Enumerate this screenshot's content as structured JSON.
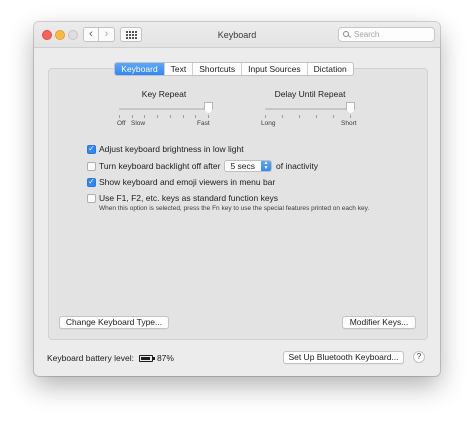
{
  "window": {
    "title": "Keyboard",
    "back_glyph": "‹",
    "forward_glyph": "›"
  },
  "search": {
    "placeholder": "Search"
  },
  "tabs": [
    {
      "label": "Keyboard",
      "active": true
    },
    {
      "label": "Text",
      "active": false
    },
    {
      "label": "Shortcuts",
      "active": false
    },
    {
      "label": "Input Sources",
      "active": false
    },
    {
      "label": "Dictation",
      "active": false
    }
  ],
  "key_repeat": {
    "title": "Key Repeat",
    "labels": [
      "Off",
      "Slow",
      "Fast"
    ],
    "tick_count": 8,
    "level": 1.0
  },
  "delay_until_repeat": {
    "title": "Delay Until Repeat",
    "labels": [
      "Long",
      "Short"
    ],
    "tick_count": 6,
    "level": 1.0
  },
  "options": {
    "adjust_brightness": {
      "label": "Adjust keyboard brightness in low light",
      "checked": true
    },
    "backlight_off": {
      "label": "Turn keyboard backlight off after",
      "checked": false,
      "select_value": "5 secs",
      "suffix": "of inactivity"
    },
    "emoji_viewers": {
      "label": "Show keyboard and emoji viewers in menu bar",
      "checked": true
    },
    "function_keys": {
      "label": "Use F1, F2, etc. keys as standard function keys",
      "checked": false,
      "note": "When this option is selected, press the Fn key to use the special features printed on each key."
    }
  },
  "buttons": {
    "change_type": "Change Keyboard Type...",
    "modifier_keys": "Modifier Keys...",
    "bluetooth_setup": "Set Up Bluetooth Keyboard...",
    "help": "?"
  },
  "battery": {
    "label": "Keyboard battery level:",
    "percent_text": "87%",
    "level": 0.87
  },
  "colors": {
    "accent": "#2f86f5",
    "close": "#fc605b",
    "minimize": "#fdbc40"
  }
}
